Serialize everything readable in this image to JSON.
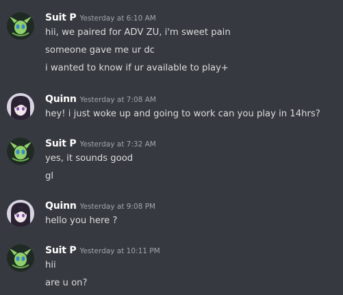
{
  "messages": [
    {
      "author": "Suit P",
      "avatar_icon": "celebi-icon",
      "timestamp": "Yesterday at 6:10 AM",
      "lines": [
        "hii, we paired for ADV ZU, i'm sweet pain",
        "someone gave me ur dc",
        "i wanted to know if ur available to play+"
      ]
    },
    {
      "author": "Quinn",
      "avatar_icon": "anime-girl-icon",
      "timestamp": "Yesterday at 7:08 AM",
      "lines": [
        "hey! i just woke up and going to work can you play in 14hrs?"
      ]
    },
    {
      "author": "Suit P",
      "avatar_icon": "celebi-icon",
      "timestamp": "Yesterday at 7:32 AM",
      "lines": [
        "yes, it sounds good",
        "gl"
      ]
    },
    {
      "author": "Quinn",
      "avatar_icon": "anime-girl-icon",
      "timestamp": "Yesterday at 9:08 PM",
      "lines": [
        "hello you here ?"
      ]
    },
    {
      "author": "Suit P",
      "avatar_icon": "celebi-icon",
      "timestamp": "Yesterday at 10:11 PM",
      "lines": [
        "hii",
        "are u on?"
      ]
    }
  ],
  "colors": {
    "background": "#36393f",
    "username": "#ffffff",
    "timestamp": "#a3a6aa",
    "message_text": "#dcddde"
  }
}
